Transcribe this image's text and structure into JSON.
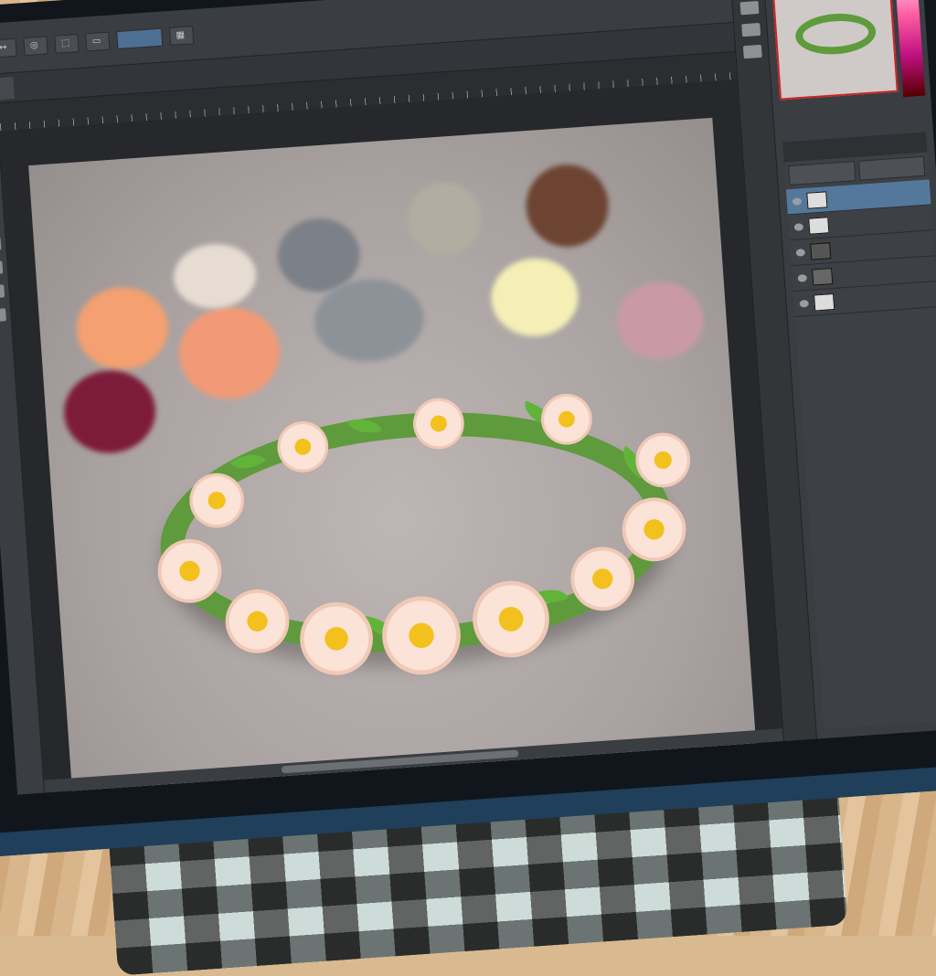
{
  "app": {
    "options_bar": {
      "buttons": [
        "↔",
        "◎",
        "⬚",
        "▭",
        "▦"
      ],
      "selected_label": ""
    },
    "document_tab": {
      "label": ""
    },
    "layers_panel": {
      "header": "",
      "layers": [
        {
          "name": "",
          "selected": true
        },
        {
          "name": "",
          "selected": false
        },
        {
          "name": "",
          "selected": false
        },
        {
          "name": "",
          "selected": false
        },
        {
          "name": "",
          "selected": false
        }
      ]
    }
  },
  "colors": {
    "canvas_bg": "#a9a2a1",
    "wreath_green": "#5f9a3c",
    "selection_blue": "#54789c",
    "accent_pink": "#ff5fa3"
  },
  "icons": [
    "move-icon",
    "marquee-icon",
    "lasso-icon",
    "crop-icon",
    "brush-icon",
    "eraser-icon",
    "type-icon",
    "zoom-icon",
    "eye-icon"
  ]
}
